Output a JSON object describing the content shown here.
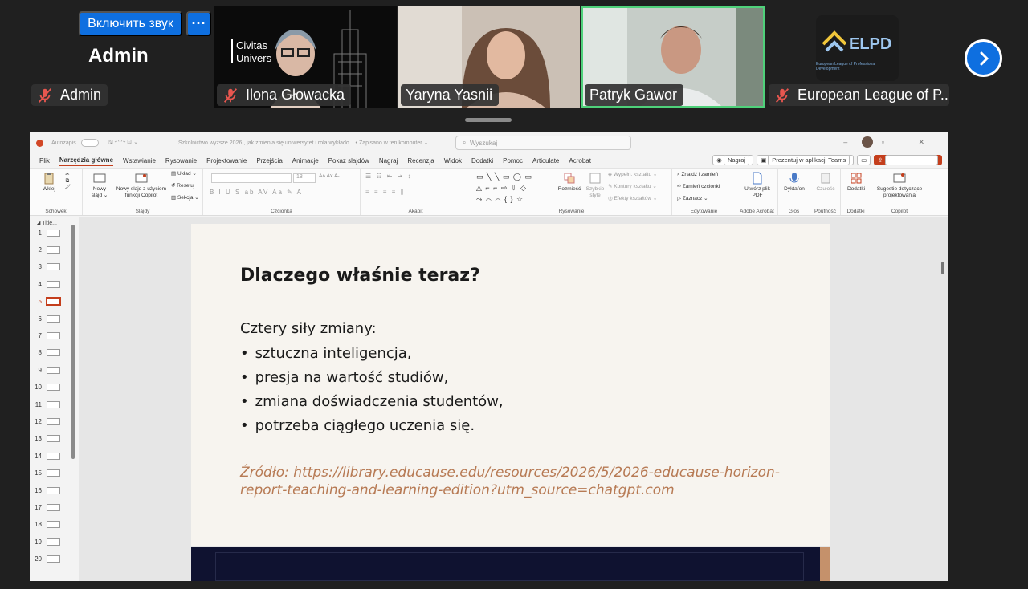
{
  "meeting": {
    "unmute_label": "Включить звук",
    "more_label": "···",
    "self_name": "Admin",
    "participants": [
      {
        "name": "Admin",
        "muted": true
      },
      {
        "name": "Ilona Głowacka",
        "muted": true
      },
      {
        "name": "Yaryna Yasnii",
        "muted": false
      },
      {
        "name": "Patryk Gawor",
        "muted": false,
        "active_speaker": true
      },
      {
        "name": "European League of P...",
        "muted": true
      }
    ],
    "ilona_logo_line1": "Civitas",
    "ilona_logo_line2": "Univers",
    "elpd_logo": "ELPD",
    "elpd_sub": "European League of Professional Development"
  },
  "ppt": {
    "titlebar": {
      "autosave": "Autozapis",
      "document": "Szkolnictwo wyższe 2026 , jak zmienia się uniwersytet i rola wykłado... • Zapisano w ten komputer ⌄",
      "search_placeholder": "Wyszukaj"
    },
    "menu": [
      "Plik",
      "Narzędzia główne",
      "Wstawianie",
      "Rysowanie",
      "Projektowanie",
      "Przejścia",
      "Animacje",
      "Pokaz slajdów",
      "Nagraj",
      "Recenzja",
      "Widok",
      "Dodatki",
      "Pomoc",
      "Articulate",
      "Acrobat"
    ],
    "menu_active": "Narzędzia główne",
    "menu_right": {
      "record": "Nagraj",
      "present_teams": "Prezentuj w aplikacji Teams",
      "share": "Udostępnianie ⌄"
    },
    "ribbon_groups": {
      "clipboard": "Schowek",
      "slides": "Slajdy",
      "font": "Czcionka",
      "paragraph": "Akapit",
      "drawing": "Rysowanie",
      "editing": "Edytowanie",
      "adobe": "Adobe Acrobat",
      "voice": "Głos",
      "sensitivity": "Poufność",
      "addins": "Dodatki",
      "copilot": "Copilot"
    },
    "ribbon_buttons": {
      "paste": "Wklej",
      "new_slide": "Nowy slajd ⌄",
      "new_slide_copilot": "Nowy slajd z użyciem funkcji Copilot",
      "layout": "Układ ⌄",
      "reset": "Resetuj",
      "section": "Sekcja ⌄",
      "arrange": "Rozmieść",
      "quick_styles": "Szybkie style",
      "shape_fill": "Wypełn. kształtu ⌄",
      "shape_outline": "Kontury kształtu ⌄",
      "shape_effects": "Efekty kształtów ⌄",
      "find_replace": "Znajdź i zamień",
      "replace_font": "Zamień czcionki",
      "select": "Zaznacz ⌄",
      "create_pdf": "Utwórz plik PDF",
      "dictate": "Dyktafon",
      "sensitivity": "Czułość",
      "addins": "Dodatki",
      "copilot_suggest": "Sugestie dotyczące projektowania"
    },
    "font_size": "18",
    "section_title": "Title...",
    "slide_numbers": [
      "1",
      "2",
      "3",
      "4",
      "5",
      "6",
      "7",
      "8",
      "9",
      "10",
      "11",
      "12",
      "13",
      "14",
      "15",
      "16",
      "17",
      "18",
      "19",
      "20"
    ],
    "selected_slide": "5",
    "slide": {
      "title": "Dlaczego właśnie teraz?",
      "intro": "Cztery siły zmiany:",
      "bullets": [
        "sztuczna inteligencja,",
        "presja na wartość studiów,",
        "zmiana doświadczenia studentów,",
        "potrzeba ciągłego uczenia się."
      ],
      "source": "Źródło: https://library.educause.edu/resources/2026/5/2026-educause-horizon-report-teaching-and-learning-edition?utm_source=chatgpt.com"
    }
  },
  "colors": {
    "meeting_bg": "#202020",
    "unmute_blue": "#0e6fe0",
    "active_speaker": "#4fd17a",
    "ppt_accent": "#c43e1c",
    "source_text": "#b77a54",
    "slide_bg": "#f7f4ef"
  },
  "icons": {
    "muted_mic": "mic-off-icon",
    "next": "chevron-right-icon"
  }
}
